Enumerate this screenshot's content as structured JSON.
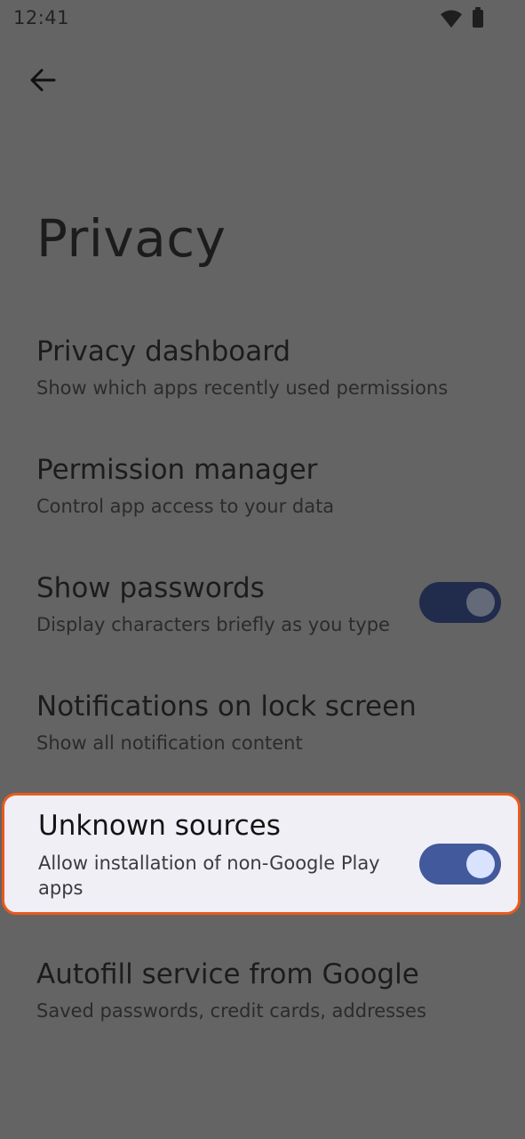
{
  "status_bar": {
    "time": "12:41",
    "icons": [
      "wifi-icon",
      "battery-icon"
    ]
  },
  "header": {
    "back_icon": "arrow-left-icon",
    "title": "Privacy"
  },
  "settings": [
    {
      "title": "Privacy dashboard",
      "subtitle": "Show which apps recently used permissions"
    },
    {
      "title": "Permission manager",
      "subtitle": "Control app access to your data"
    },
    {
      "title": "Show passwords",
      "subtitle": "Display characters briefly as you type",
      "toggle": "on"
    },
    {
      "title": "Notifications on lock screen",
      "subtitle": "Show all notification content"
    },
    {
      "title": "Unknown sources",
      "subtitle": "Allow installation of non-Google Play apps",
      "toggle": "on",
      "highlighted": true
    },
    {
      "title": "Autofill service from Google",
      "subtitle": "Saved passwords, credit cards, addresses"
    }
  ],
  "colors": {
    "scrim_background": "#646464",
    "highlight_border": "#ea5a1b",
    "highlight_background": "#f1eff6",
    "toggle_track_dimmed": "#212c4c",
    "toggle_thumb_dimmed": "#646a77",
    "toggle_track_active": "#42599b",
    "toggle_thumb_active": "#d9e2ff"
  }
}
